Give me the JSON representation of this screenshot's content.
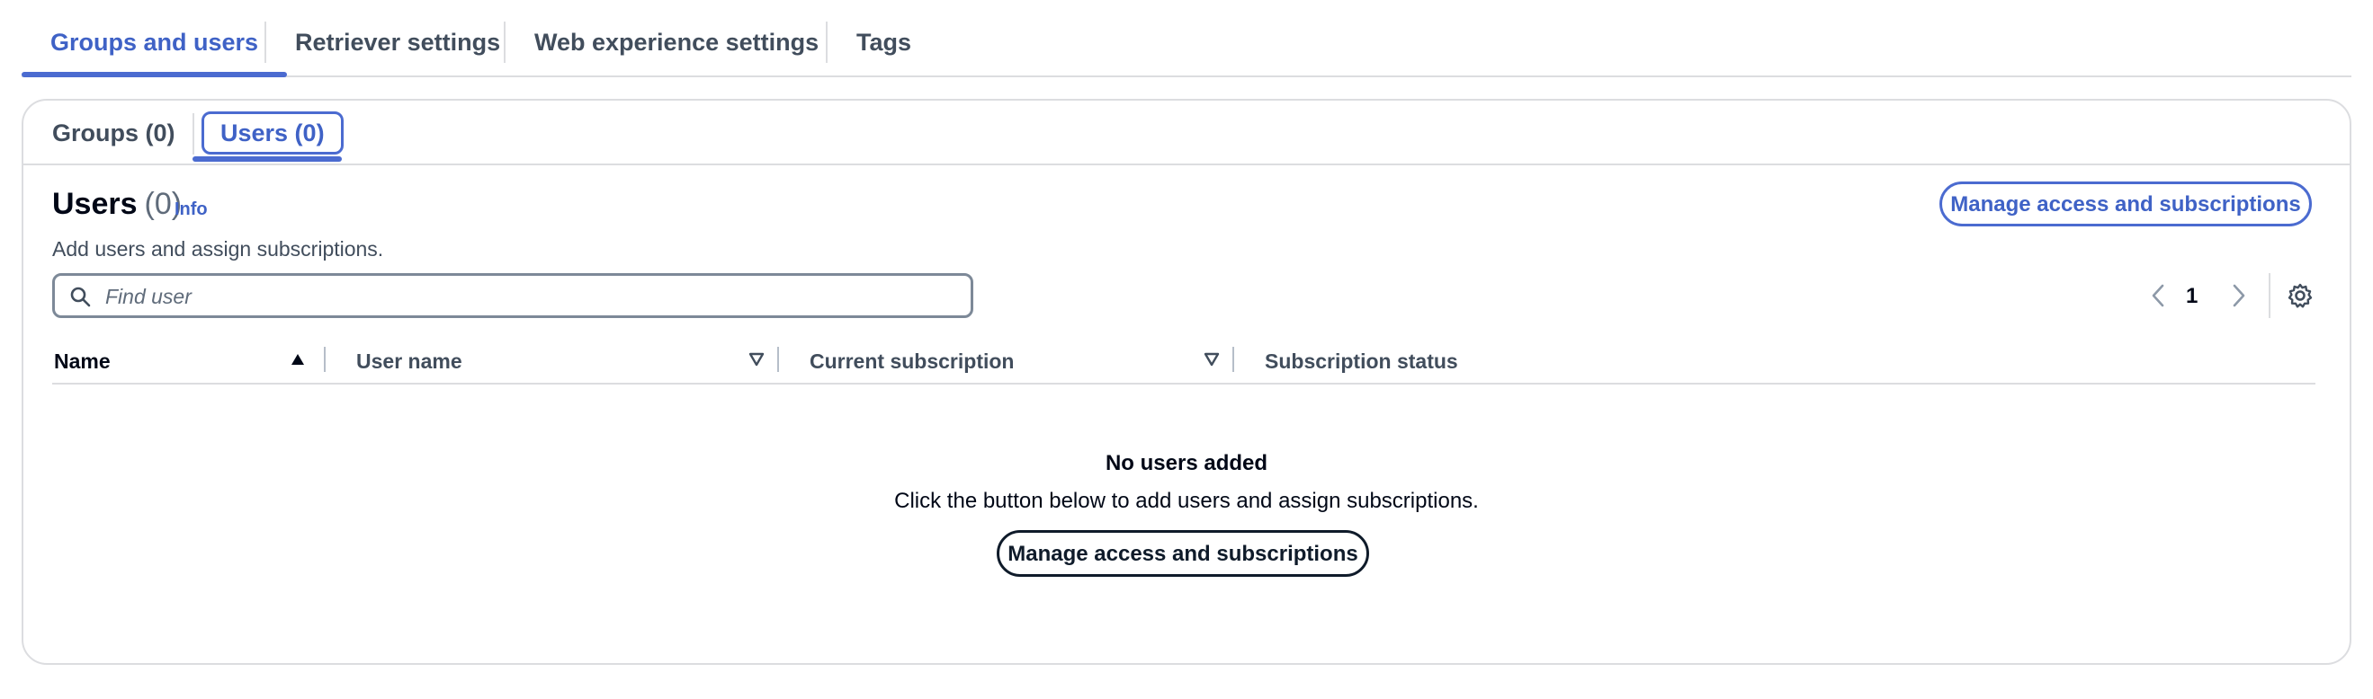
{
  "top_tabs": [
    {
      "label": "Groups and users",
      "active": true
    },
    {
      "label": "Retriever settings",
      "active": false
    },
    {
      "label": "Web experience settings",
      "active": false
    },
    {
      "label": "Tags",
      "active": false
    }
  ],
  "inner_tabs": [
    {
      "label": "Groups (0)",
      "active": false
    },
    {
      "label": "Users (0)",
      "active": true
    }
  ],
  "header": {
    "title": "Users",
    "count": "(0)",
    "info_label": "Info",
    "description": "Add users and assign subscriptions.",
    "action_label": "Manage access and subscriptions"
  },
  "search": {
    "placeholder": "Find user",
    "value": ""
  },
  "pagination": {
    "current_page": "1"
  },
  "table": {
    "columns": [
      {
        "label": "Name",
        "sort": "ascending"
      },
      {
        "label": "User name",
        "sort": "none"
      },
      {
        "label": "Current subscription",
        "sort": "none"
      },
      {
        "label": "Subscription status",
        "sort": "none"
      }
    ]
  },
  "empty_state": {
    "title": "No users added",
    "description": "Click the button below to add users and assign subscriptions.",
    "action_label": "Manage access and subscriptions"
  },
  "colors": {
    "accent": "#4b6bd0",
    "text": "#000716",
    "muted": "#414d5c",
    "border": "#dcdde0"
  },
  "icons": {
    "search": "search-icon",
    "prev": "chevron-left-icon",
    "next": "chevron-right-icon",
    "settings": "gear-icon",
    "sort_ascending": "caret-up-filled-icon",
    "sort_none": "caret-down-outline-icon"
  }
}
